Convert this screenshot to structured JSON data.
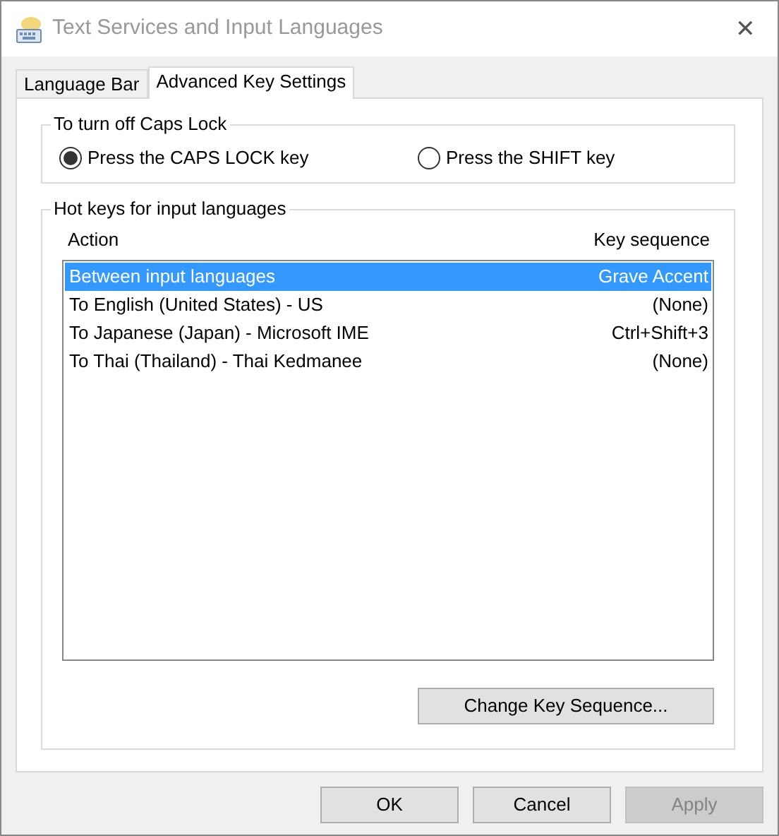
{
  "window": {
    "title": "Text Services and Input Languages",
    "close": "✕"
  },
  "tabs": [
    {
      "label": "Language Bar",
      "selected": false
    },
    {
      "label": "Advanced Key Settings",
      "selected": true
    }
  ],
  "caps_lock": {
    "title": "To turn off Caps Lock",
    "options": [
      {
        "label": "Press the CAPS LOCK key",
        "selected": true
      },
      {
        "label": "Press the SHIFT key",
        "selected": false
      }
    ]
  },
  "hot_keys": {
    "title": "Hot keys for input languages",
    "columns": [
      "Action",
      "Key sequence"
    ],
    "rows": [
      {
        "action": "Between input languages",
        "key": "Grave Accent",
        "selected": true
      },
      {
        "action": "To English (United States) - US",
        "key": "(None)",
        "selected": false
      },
      {
        "action": "To Japanese (Japan) - Microsoft IME",
        "key": "Ctrl+Shift+3",
        "selected": false
      },
      {
        "action": "To Thai (Thailand) - Thai Kedmanee",
        "key": "(None)",
        "selected": false
      }
    ],
    "change_button": "Change Key Sequence..."
  },
  "buttons": [
    {
      "label": "OK",
      "disabled": false
    },
    {
      "label": "Cancel",
      "disabled": false
    },
    {
      "label": "Apply",
      "disabled": true
    }
  ]
}
